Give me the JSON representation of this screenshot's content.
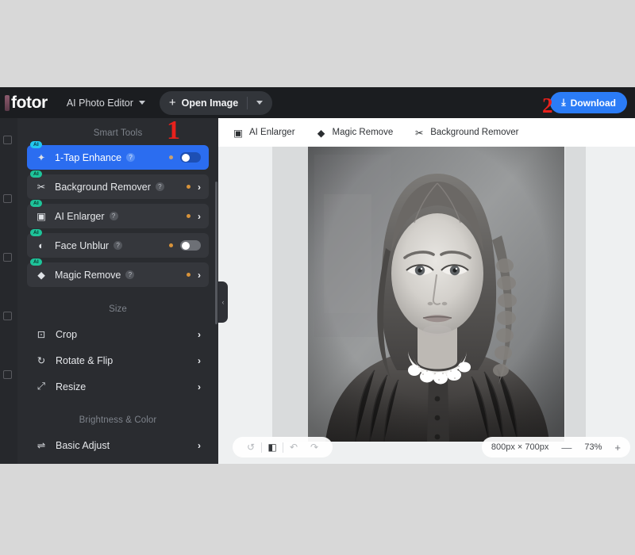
{
  "window": {
    "brand": "fotor",
    "editor_mode": "AI Photo Editor",
    "open_image_label": "Open Image",
    "download_label": "Download",
    "download_color": "#2b7cf6"
  },
  "sidebar": {
    "sections": [
      {
        "title": "Smart Tools"
      },
      {
        "title": "Size"
      },
      {
        "title": "Brightness & Color"
      }
    ],
    "smart_tools": [
      {
        "badge": "AI",
        "icon": "magic-wand-icon",
        "label": "1-Tap Enhance",
        "help": "?",
        "control": "toggle-on",
        "active": true
      },
      {
        "badge": "AI",
        "icon": "scissors-icon",
        "label": "Background Remover",
        "help": "?",
        "control": "chevron",
        "active": false
      },
      {
        "badge": "AI",
        "icon": "image-expand-icon",
        "label": "AI Enlarger",
        "help": "?",
        "control": "chevron",
        "active": false
      },
      {
        "badge": "AI",
        "icon": "contrast-icon",
        "label": "Face Unblur",
        "help": "?",
        "control": "toggle-off",
        "active": false
      },
      {
        "badge": "AI",
        "icon": "eraser-icon",
        "label": "Magic Remove",
        "help": "?",
        "control": "chevron",
        "active": false
      }
    ],
    "size_tools": [
      {
        "icon": "crop-icon",
        "label": "Crop"
      },
      {
        "icon": "rotate-icon",
        "label": "Rotate & Flip"
      },
      {
        "icon": "resize-icon",
        "label": "Resize"
      }
    ],
    "color_tools": [
      {
        "icon": "sliders-icon",
        "label": "Basic Adjust"
      }
    ],
    "collapse_icon": "chevron-left-icon"
  },
  "canvas": {
    "tools": [
      {
        "icon": "ai-enlarger-icon",
        "label": "AI Enlarger"
      },
      {
        "icon": "magic-remove-icon",
        "label": "Magic Remove"
      },
      {
        "icon": "background-remover-icon",
        "label": "Background Remover"
      }
    ],
    "bottom_left_icons": [
      "reset-icon",
      "compare-icon",
      "undo-icon",
      "redo-icon"
    ],
    "dimensions": "800px × 700px",
    "zoom_out": "—",
    "zoom_level": "73%",
    "zoom_in": "+"
  },
  "annotations": {
    "marker_1": "1",
    "marker_2": "2",
    "color": "#e8211c"
  }
}
